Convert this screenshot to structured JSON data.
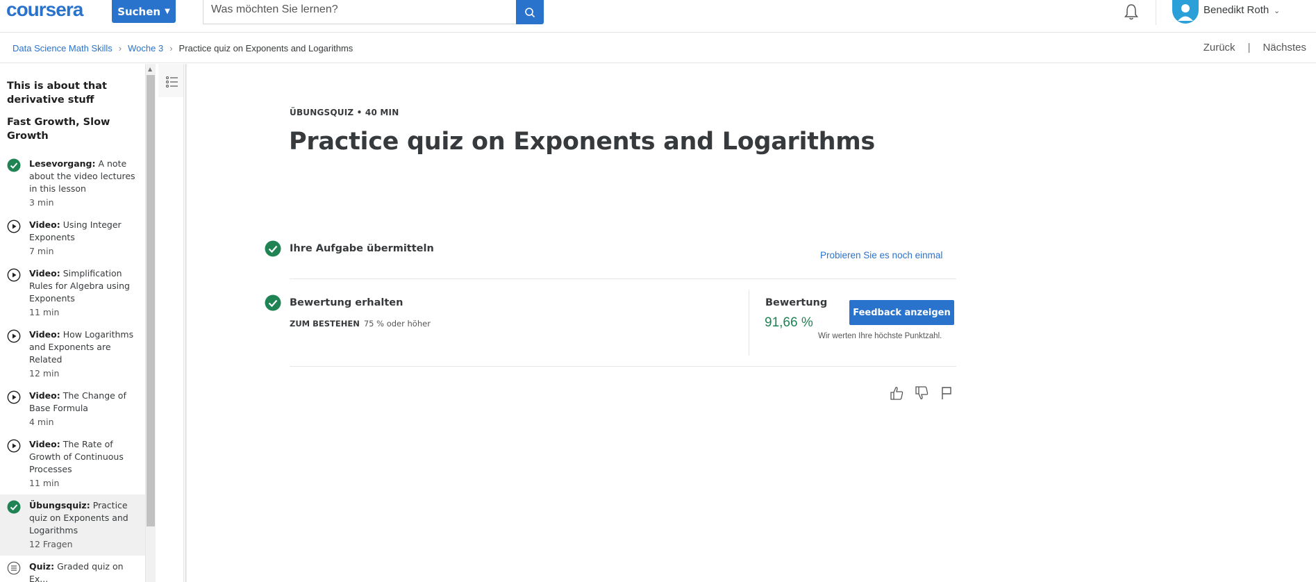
{
  "header": {
    "logo": "coursera",
    "search_button": "Suchen",
    "search_placeholder": "Was möchten Sie lernen?",
    "user_name": "Benedikt Roth"
  },
  "breadcrumb": {
    "items": [
      "Data Science Math Skills",
      "Woche 3"
    ],
    "current": "Practice quiz on Exponents and Logarithms",
    "back": "Zurück",
    "separator": "|",
    "next": "Nächstes"
  },
  "sidebar": {
    "lesson_title": "This is about that derivative stuff",
    "section_title": "Fast Growth, Slow Growth",
    "items": [
      {
        "type": "Lesevorgang:",
        "title": "A note about the video lectures in this lesson",
        "duration": "3 min",
        "icon": "check-icon"
      },
      {
        "type": "Video:",
        "title": "Using Integer Exponents",
        "duration": "7 min",
        "icon": "play-icon"
      },
      {
        "type": "Video:",
        "title": "Simplification Rules for Algebra using Exponents",
        "duration": "11 min",
        "icon": "play-icon"
      },
      {
        "type": "Video:",
        "title": "How Logarithms and Exponents are Related",
        "duration": "12 min",
        "icon": "play-icon"
      },
      {
        "type": "Video:",
        "title": "The Change of Base Formula",
        "duration": "4 min",
        "icon": "play-icon"
      },
      {
        "type": "Video:",
        "title": "The Rate of Growth of Continuous Processes",
        "duration": "11 min",
        "icon": "play-icon"
      },
      {
        "type": "Übungsquiz:",
        "title": "Practice quiz on Exponents and Logarithms",
        "duration": "12 Fragen",
        "icon": "check-icon"
      },
      {
        "type": "Quiz:",
        "title": "Graded quiz on Ex...",
        "duration": "",
        "icon": "quiz-icon"
      }
    ]
  },
  "main": {
    "eyebrow": "ÜBUNGSQUIZ • 40 MIN",
    "title": "Practice quiz on Exponents and Logarithms",
    "step1_label": "Ihre Aufgabe übermitteln",
    "retry_link": "Probieren Sie es noch einmal",
    "step2_label": "Bewertung erhalten",
    "pass_label": "ZUM BESTEHEN",
    "pass_value": "75 % oder höher",
    "grade_label": "Bewertung",
    "grade_value": "91,66 %",
    "feedback_button": "Feedback anzeigen",
    "highest_note": "Wir werten Ihre höchste Punktzahl."
  },
  "colors": {
    "brand_blue": "#2a73cc",
    "success_green": "#1f8354"
  }
}
